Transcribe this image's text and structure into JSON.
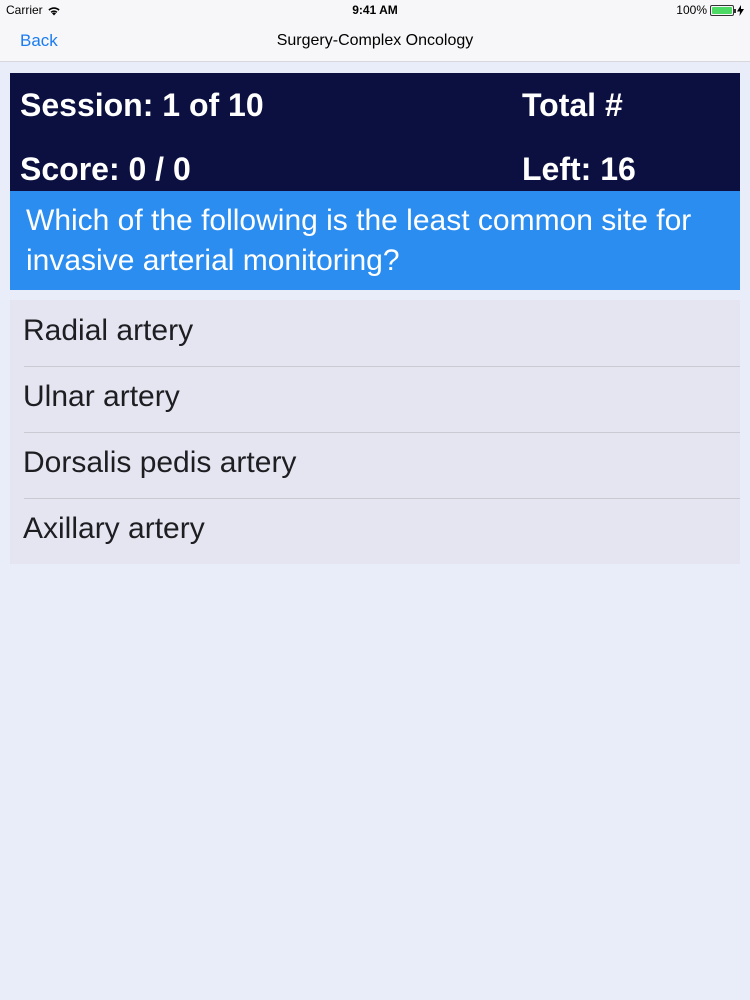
{
  "status_bar": {
    "carrier": "Carrier",
    "time": "9:41 AM",
    "battery": "100%"
  },
  "nav": {
    "back_label": "Back",
    "title": "Surgery-Complex Oncology"
  },
  "header": {
    "session": "Session: 1 of 10",
    "total_label": "Total #",
    "score": "Score: 0 / 0",
    "left": "Left: 16"
  },
  "question": {
    "text": "Which of the following is the least common site for invasive arterial monitoring?"
  },
  "answers": [
    {
      "label": "Radial artery"
    },
    {
      "label": "Ulnar artery"
    },
    {
      "label": "Dorsalis pedis artery"
    },
    {
      "label": "Axillary artery"
    }
  ],
  "colors": {
    "header_bg": "#0c1040",
    "question_bg": "#2b8df0",
    "accent": "#1a7cf0",
    "battery": "#4cd964"
  },
  "icons": [
    "wifi-icon",
    "battery-icon",
    "charging-bolt-icon"
  ]
}
